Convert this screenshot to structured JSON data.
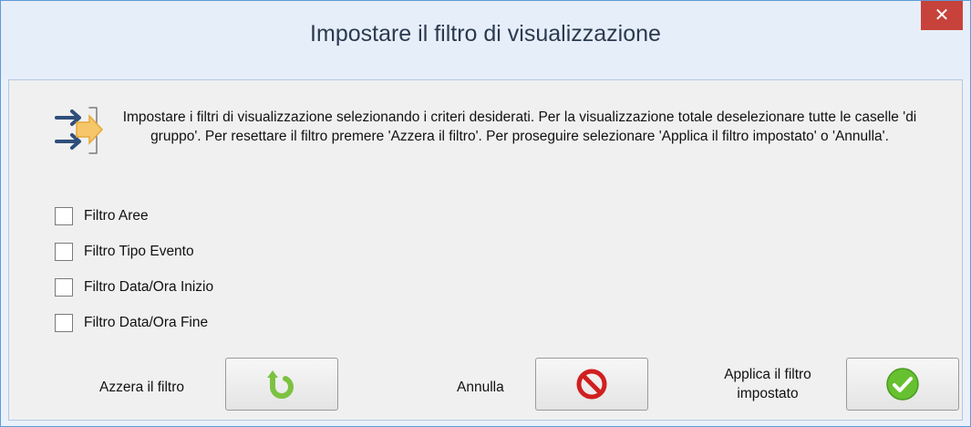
{
  "window": {
    "title": "Impostare il filtro di visualizzazione",
    "close_glyph": "✕"
  },
  "message": "Impostare i filtri di visualizzazione selezionando i criteri desiderati. Per la visualizzazione totale deselezionare tutte le caselle 'di gruppo'. Per resettare il filtro premere 'Azzera il filtro'. Per proseguire selezionare 'Applica il filtro impostato' o 'Annulla'.",
  "filters": [
    {
      "label": "Filtro Aree",
      "checked": false
    },
    {
      "label": "Filtro Tipo Evento",
      "checked": false
    },
    {
      "label": "Filtro Data/Ora Inizio",
      "checked": false
    },
    {
      "label": "Filtro Data/Ora Fine",
      "checked": false
    }
  ],
  "buttons": {
    "reset_label": "Azzera il filtro",
    "cancel_label": "Annulla",
    "apply_label": "Applica il filtro impostato"
  },
  "icons": {
    "info": "filter-arrows-icon",
    "reset": "reset-arrow-icon",
    "cancel": "no-entry-icon",
    "apply": "checkmark-icon"
  },
  "colors": {
    "title_bar": "#e6eef9",
    "close_button": "#c7423b",
    "reset_green": "#7cc242",
    "cancel_red": "#d11f1f",
    "apply_green": "#66c02f"
  }
}
